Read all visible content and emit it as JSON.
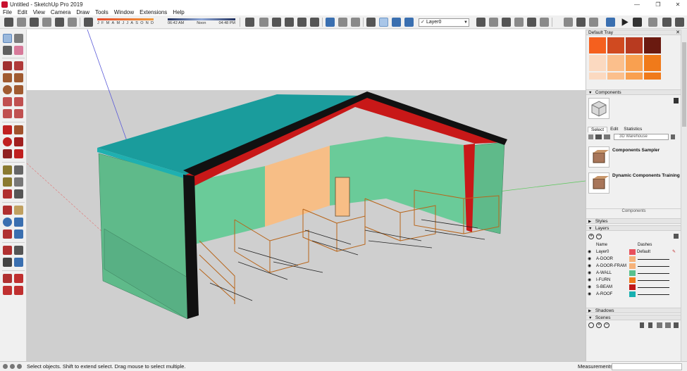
{
  "window": {
    "title": "Untitled - SketchUp Pro 2019",
    "min": "—",
    "max": "❐",
    "close": "✕"
  },
  "menu": [
    "File",
    "Edit",
    "View",
    "Camera",
    "Draw",
    "Tools",
    "Window",
    "Extensions",
    "Help"
  ],
  "toolbar": {
    "months": [
      "J",
      "F",
      "M",
      "A",
      "M",
      "J",
      "J",
      "A",
      "S",
      "O",
      "N",
      "D"
    ],
    "time_start": "06:42 AM",
    "time_noon": "Noon",
    "time_end": "04:48 PM",
    "layer_value": "Layer0"
  },
  "tray": {
    "title": "Default Tray",
    "colors": [
      "#f2501c",
      "#cc3b1e",
      "#b8281c",
      "#6a1a10",
      "#fbd9c0",
      "#fbbf8c",
      "#f9a050",
      "#f07a1a"
    ],
    "components_header": "Components",
    "tabs": [
      "Select",
      "Edit",
      "Statistics"
    ],
    "search_placeholder": "3D Warehouse",
    "items": [
      {
        "label": "Components Sampler"
      },
      {
        "label": "Dynamic Components Training"
      }
    ],
    "components_footer": "Components",
    "styles_header": "Styles",
    "layers_header": "Layers",
    "layer_col_name": "Name",
    "layer_col_dashes": "Dashes",
    "layers": [
      {
        "name": "Layer0",
        "color": "#e8505b",
        "dash": "Default"
      },
      {
        "name": "A-DOOR",
        "color": "#f6b27a",
        "dash": ""
      },
      {
        "name": "A-DOOR-FRAM",
        "color": "#f6b27a",
        "dash": ""
      },
      {
        "name": "A-WALL",
        "color": "#58c08d",
        "dash": ""
      },
      {
        "name": "I-FURN",
        "color": "#f07a1a",
        "dash": ""
      },
      {
        "name": "S-BEAM",
        "color": "#c01818",
        "dash": ""
      },
      {
        "name": "A-ROOF",
        "color": "#18b0b0",
        "dash": ""
      }
    ],
    "shadows_header": "Shadows",
    "scenes_header": "Scenes"
  },
  "status": {
    "hint": "Select objects. Shift to extend select. Drag mouse to select multiple.",
    "measurements_label": "Measurements"
  }
}
